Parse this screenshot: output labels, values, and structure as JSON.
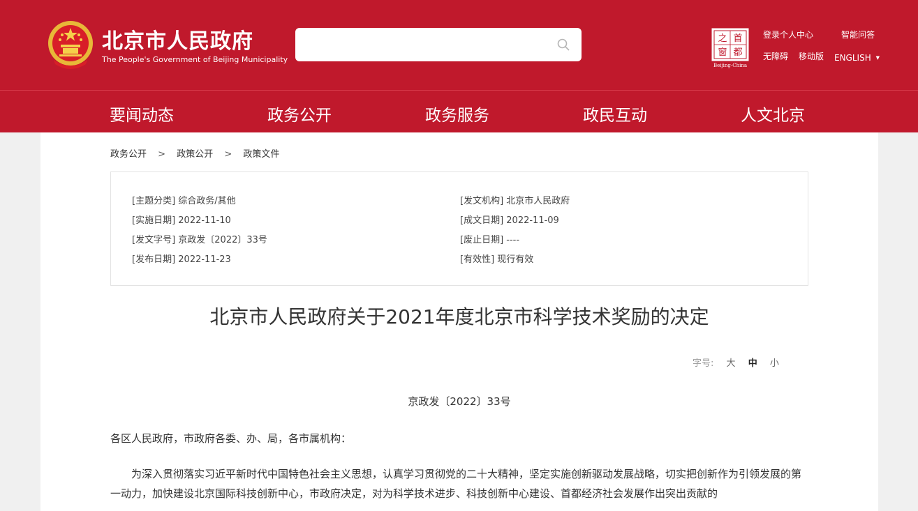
{
  "header": {
    "title": "北京市人民政府",
    "subtitle": "The People's Government of Beijing Municipality",
    "search_placeholder": "",
    "capital_logo_chars": [
      "首",
      "都",
      "之",
      "窗"
    ],
    "capital_logo_caption": "Beijing-China",
    "links": {
      "login": "登录个人中心",
      "smart_qa": "智能问答",
      "accessible": "无障碍",
      "mobile": "移动版",
      "english": "ENGLISH",
      "english_caret": "▼"
    },
    "brand_color": "#c0192c"
  },
  "nav": {
    "items": [
      "要闻动态",
      "政务公开",
      "政务服务",
      "政民互动",
      "人文北京"
    ]
  },
  "breadcrumb": {
    "items": [
      "政务公开",
      "政策公开",
      "政策文件"
    ],
    "separator": ">"
  },
  "meta": {
    "topic": "[主题分类] 综合政务/其他",
    "issuer": "[发文机构] 北京市人民政府",
    "effective_date": "[实施日期] 2022-11-10",
    "written_date": "[成文日期] 2022-11-09",
    "doc_no": "[发文字号] 京政发〔2022〕33号",
    "expiry_date": "[废止日期] ----",
    "publish_date": "[发布日期] 2022-11-23",
    "validity": "[有效性] 现行有效"
  },
  "document": {
    "title": "北京市人民政府关于2021年度北京市科学技术奖励的决定",
    "font_size_label": "字号:",
    "font_sizes": [
      "大",
      "中",
      "小"
    ],
    "active_font_size": "中",
    "number": "京政发〔2022〕33号",
    "recipients": "各区人民政府，市政府各委、办、局，各市属机构：",
    "paragraph_1": "为深入贯彻落实习近平新时代中国特色社会主义思想，认真学习贯彻党的二十大精神，坚定实施创新驱动发展战略，切实把创新作为引领发展的第一动力，加快建设北京国际科技创新中心，市政府决定，对为科学技术进步、科技创新中心建设、首都经济社会发展作出突出贡献的"
  },
  "icons": {
    "search": "search-icon",
    "emblem": "national-emblem-icon",
    "capital_logo": "capital-window-logo-icon"
  }
}
